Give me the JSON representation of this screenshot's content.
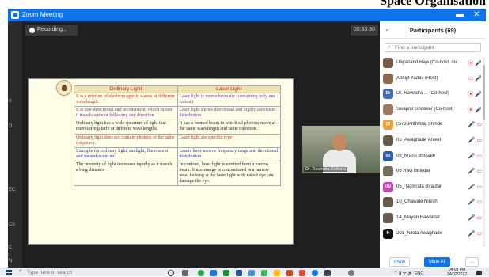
{
  "header_text": "Space Organisation",
  "window": {
    "title": "Zoom Meeting",
    "minimize": "▬",
    "close": "✕"
  },
  "recording": {
    "label": "Recording..."
  },
  "timer": "00:33:30",
  "left_strip": [
    "Ir",
    "D",
    "EC",
    "Co",
    "C",
    "N"
  ],
  "slide": {
    "headers": [
      "Ordinary Light",
      "Laser Light"
    ],
    "rows": [
      {
        "left": "It is a mixture of electromagnetic waves of different wavelength.",
        "right": "Laser light is monochromatic (containing only one colour)",
        "lc": "#c0392b",
        "rc": "#7a3aa0"
      },
      {
        "left": "It is non-directional and inconsistent, which means it travels without following any direction.",
        "right": "Laser light shows directional and highly consistent distribution.",
        "lc": "#7a3aa0",
        "rc": "#7a3aa0"
      },
      {
        "left": "Ordinary light has a wide spectrum of light that moves irregularly at different wavelengths.",
        "right": "It has a formed beam in which all photons move at the same wavelength and same direction.",
        "lc": "#222222",
        "rc": "#222222"
      },
      {
        "left": "Ordinary light does not contain photons of the same frequency.",
        "right": "Laser light are specific type",
        "lc": "#c0392b",
        "rc": "#c0392b"
      },
      {
        "left": "Example for ordinary light, sunlight, fluorescent and incandescent etc.",
        "right": "Lasers have narrow frequency range and directional distribution",
        "lc": "#2f3aa8",
        "rc": "#2f3aa8"
      },
      {
        "left": "The intensity of light decreases rapidly as it travels a long distance",
        "right": "In contrast, laser light is emitted from a narrow beam. Since energy is concentrated in a narrow area, looking at the laser light with naked eye can damage the eye.",
        "lc": "#222222",
        "rc": "#222222"
      }
    ]
  },
  "camera": {
    "name": "Dr. Ravindra Kothare"
  },
  "participants": {
    "title": "Participants (69)",
    "find_placeholder": "Find a participant",
    "list": [
      {
        "initials": "",
        "color": "#7b5a44",
        "name": "Dayanand Raje (Co-host, me)",
        "icons": "⦿ 🎤"
      },
      {
        "initials": "",
        "color": "#8b6a50",
        "name": "Abhijit Yadav (Host)",
        "icons": "▭ 🎤"
      },
      {
        "initials": "Dr",
        "color": "#3a6fb0",
        "name": "Dr. Ravindra ... (Co-host)",
        "icons": "⦿ 🎤"
      },
      {
        "initials": "",
        "color": "#a07860",
        "name": "Swapnil Ghdekar (Co-host)",
        "icons": "⦿ 🎤"
      },
      {
        "initials": "(S",
        "color": "#f0a030",
        "name": "(S73)Prithviraj Shinde",
        "icons": "🎤 ▭"
      },
      {
        "initials": "",
        "color": "#6a5a4a",
        "name": "05_Awaghade Aniket",
        "icons": "🎤 ▭"
      },
      {
        "initials": "06",
        "color": "#2a5db0",
        "name": "06_Kranti Bhosale",
        "icons": "🎤 ▭"
      },
      {
        "initials": "",
        "color": "#7a6a5a",
        "name": "08 Ravi Birajdar",
        "icons": "🎤 ▭"
      },
      {
        "initials": "0N",
        "color": "#c04ab0",
        "name": "05_ Namrata Birajdar",
        "icons": "🎤 ▭"
      },
      {
        "initials": "",
        "color": "#6a5a4a",
        "name": "10_Chawale Nilesh",
        "icons": "🎤 ▭"
      },
      {
        "initials": "",
        "color": "#6a5a4a",
        "name": "14_Mayuri Hawaldar",
        "icons": "🎤 ▭"
      },
      {
        "initials": "N",
        "color": "#111111",
        "name": "201_Nikita Awaghade",
        "icons": "🎤 ▭"
      }
    ],
    "invite": "Invite",
    "mute_all": "Mute All",
    "more": "..."
  },
  "taskbar": {
    "search_placeholder": "Type here to search",
    "tray": "⌃ ▮ ᯤ 🔊 ENG",
    "time": "04:03 PM",
    "date": "24/02/2022"
  }
}
